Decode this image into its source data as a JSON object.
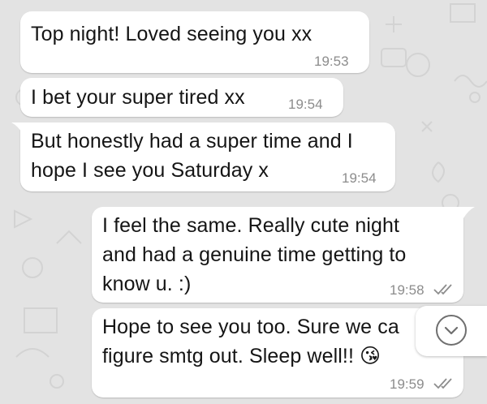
{
  "messages": [
    {
      "direction": "incoming",
      "text": "Top night! Loved seeing you xx",
      "time": "19:53"
    },
    {
      "direction": "incoming",
      "text": "I bet your super tired xx",
      "time": "19:54"
    },
    {
      "direction": "incoming",
      "text": "But honestly had a super time and I\nhope I see you Saturday x",
      "time": "19:54"
    },
    {
      "direction": "outgoing",
      "text": "I feel the same. Really cute night\nand had a genuine time getting to\nknow u. :)",
      "time": "19:58",
      "status": "read"
    },
    {
      "direction": "outgoing",
      "text": "Hope to see you too. Sure we ca\nfigure smtg out. Sleep well!! 😘",
      "time": "19:59",
      "status": "read"
    }
  ],
  "icons": {
    "read_receipt": "double-check-icon",
    "scroll_down": "chevron-down-icon"
  },
  "colors": {
    "background": "#e3e3e3",
    "bubble": "#ffffff",
    "timestamp": "#8c8c8c",
    "tick": "#8c8c8c"
  }
}
